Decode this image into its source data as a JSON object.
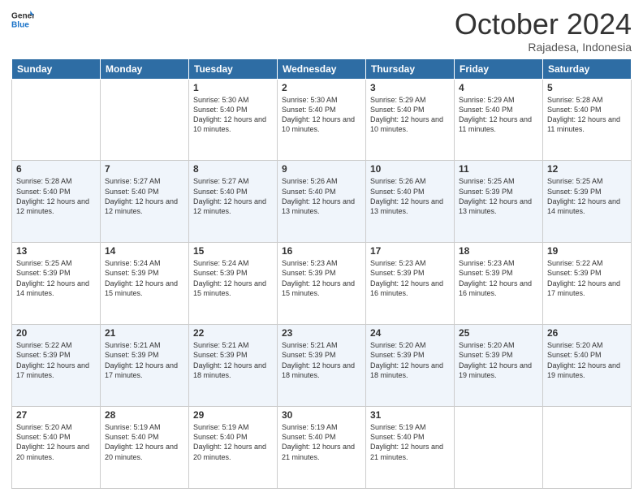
{
  "header": {
    "logo_general": "General",
    "logo_blue": "Blue",
    "month_title": "October 2024",
    "location": "Rajadesa, Indonesia"
  },
  "weekdays": [
    "Sunday",
    "Monday",
    "Tuesday",
    "Wednesday",
    "Thursday",
    "Friday",
    "Saturday"
  ],
  "weeks": [
    [
      {
        "day": "",
        "info": ""
      },
      {
        "day": "",
        "info": ""
      },
      {
        "day": "1",
        "info": "Sunrise: 5:30 AM\nSunset: 5:40 PM\nDaylight: 12 hours and 10 minutes."
      },
      {
        "day": "2",
        "info": "Sunrise: 5:30 AM\nSunset: 5:40 PM\nDaylight: 12 hours and 10 minutes."
      },
      {
        "day": "3",
        "info": "Sunrise: 5:29 AM\nSunset: 5:40 PM\nDaylight: 12 hours and 10 minutes."
      },
      {
        "day": "4",
        "info": "Sunrise: 5:29 AM\nSunset: 5:40 PM\nDaylight: 12 hours and 11 minutes."
      },
      {
        "day": "5",
        "info": "Sunrise: 5:28 AM\nSunset: 5:40 PM\nDaylight: 12 hours and 11 minutes."
      }
    ],
    [
      {
        "day": "6",
        "info": "Sunrise: 5:28 AM\nSunset: 5:40 PM\nDaylight: 12 hours and 12 minutes."
      },
      {
        "day": "7",
        "info": "Sunrise: 5:27 AM\nSunset: 5:40 PM\nDaylight: 12 hours and 12 minutes."
      },
      {
        "day": "8",
        "info": "Sunrise: 5:27 AM\nSunset: 5:40 PM\nDaylight: 12 hours and 12 minutes."
      },
      {
        "day": "9",
        "info": "Sunrise: 5:26 AM\nSunset: 5:40 PM\nDaylight: 12 hours and 13 minutes."
      },
      {
        "day": "10",
        "info": "Sunrise: 5:26 AM\nSunset: 5:40 PM\nDaylight: 12 hours and 13 minutes."
      },
      {
        "day": "11",
        "info": "Sunrise: 5:25 AM\nSunset: 5:39 PM\nDaylight: 12 hours and 13 minutes."
      },
      {
        "day": "12",
        "info": "Sunrise: 5:25 AM\nSunset: 5:39 PM\nDaylight: 12 hours and 14 minutes."
      }
    ],
    [
      {
        "day": "13",
        "info": "Sunrise: 5:25 AM\nSunset: 5:39 PM\nDaylight: 12 hours and 14 minutes."
      },
      {
        "day": "14",
        "info": "Sunrise: 5:24 AM\nSunset: 5:39 PM\nDaylight: 12 hours and 15 minutes."
      },
      {
        "day": "15",
        "info": "Sunrise: 5:24 AM\nSunset: 5:39 PM\nDaylight: 12 hours and 15 minutes."
      },
      {
        "day": "16",
        "info": "Sunrise: 5:23 AM\nSunset: 5:39 PM\nDaylight: 12 hours and 15 minutes."
      },
      {
        "day": "17",
        "info": "Sunrise: 5:23 AM\nSunset: 5:39 PM\nDaylight: 12 hours and 16 minutes."
      },
      {
        "day": "18",
        "info": "Sunrise: 5:23 AM\nSunset: 5:39 PM\nDaylight: 12 hours and 16 minutes."
      },
      {
        "day": "19",
        "info": "Sunrise: 5:22 AM\nSunset: 5:39 PM\nDaylight: 12 hours and 17 minutes."
      }
    ],
    [
      {
        "day": "20",
        "info": "Sunrise: 5:22 AM\nSunset: 5:39 PM\nDaylight: 12 hours and 17 minutes."
      },
      {
        "day": "21",
        "info": "Sunrise: 5:21 AM\nSunset: 5:39 PM\nDaylight: 12 hours and 17 minutes."
      },
      {
        "day": "22",
        "info": "Sunrise: 5:21 AM\nSunset: 5:39 PM\nDaylight: 12 hours and 18 minutes."
      },
      {
        "day": "23",
        "info": "Sunrise: 5:21 AM\nSunset: 5:39 PM\nDaylight: 12 hours and 18 minutes."
      },
      {
        "day": "24",
        "info": "Sunrise: 5:20 AM\nSunset: 5:39 PM\nDaylight: 12 hours and 18 minutes."
      },
      {
        "day": "25",
        "info": "Sunrise: 5:20 AM\nSunset: 5:39 PM\nDaylight: 12 hours and 19 minutes."
      },
      {
        "day": "26",
        "info": "Sunrise: 5:20 AM\nSunset: 5:40 PM\nDaylight: 12 hours and 19 minutes."
      }
    ],
    [
      {
        "day": "27",
        "info": "Sunrise: 5:20 AM\nSunset: 5:40 PM\nDaylight: 12 hours and 20 minutes."
      },
      {
        "day": "28",
        "info": "Sunrise: 5:19 AM\nSunset: 5:40 PM\nDaylight: 12 hours and 20 minutes."
      },
      {
        "day": "29",
        "info": "Sunrise: 5:19 AM\nSunset: 5:40 PM\nDaylight: 12 hours and 20 minutes."
      },
      {
        "day": "30",
        "info": "Sunrise: 5:19 AM\nSunset: 5:40 PM\nDaylight: 12 hours and 21 minutes."
      },
      {
        "day": "31",
        "info": "Sunrise: 5:19 AM\nSunset: 5:40 PM\nDaylight: 12 hours and 21 minutes."
      },
      {
        "day": "",
        "info": ""
      },
      {
        "day": "",
        "info": ""
      }
    ]
  ]
}
